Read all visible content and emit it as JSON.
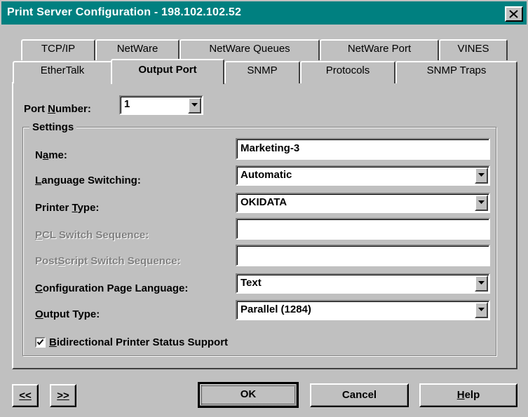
{
  "window": {
    "title": "Print Server Configuration - 198.102.102.52",
    "title_bar_color": "#008080",
    "face_color": "#c0c0c0"
  },
  "tabs": {
    "row_back": [
      "TCP/IP",
      "NetWare",
      "NetWare Queues",
      "NetWare Port",
      "VINES"
    ],
    "row_front": [
      "EtherTalk",
      "Output Port",
      "SNMP",
      "Protocols",
      "SNMP Traps"
    ],
    "active": "Output Port"
  },
  "port_number": {
    "label_pre": "Port ",
    "label_u": "N",
    "label_post": "umber:",
    "value": "1"
  },
  "settings": {
    "group_label": "Settings",
    "name": {
      "label_pre": "N",
      "label_u": "a",
      "label_post": "me:",
      "value": "Marketing-3"
    },
    "language_switching": {
      "label_u": "L",
      "label_post": "anguage Switching:",
      "value": "Automatic"
    },
    "printer_type": {
      "label_pre": "Printer ",
      "label_u": "T",
      "label_post": "ype:",
      "value": "OKIDATA"
    },
    "pcl_switch": {
      "label_u": "P",
      "label_post": "CL Switch Sequence:",
      "value": ""
    },
    "postscript_switch": {
      "label_pre": "Post",
      "label_u": "S",
      "label_post": "cript Switch Sequence:",
      "value": ""
    },
    "config_page_language": {
      "label_u": "C",
      "label_post": "onfiguration Page Language:",
      "value": "Text"
    },
    "output_type": {
      "label_u": "O",
      "label_post": "utput Type:",
      "value": "Parallel (1284)"
    },
    "bidirectional": {
      "label_u": "B",
      "label_post": "idirectional Printer Status Support",
      "checked": true
    }
  },
  "buttons": {
    "prev": "<<",
    "next": ">>",
    "ok": "OK",
    "cancel": "Cancel",
    "help_u": "H",
    "help_post": "elp"
  }
}
